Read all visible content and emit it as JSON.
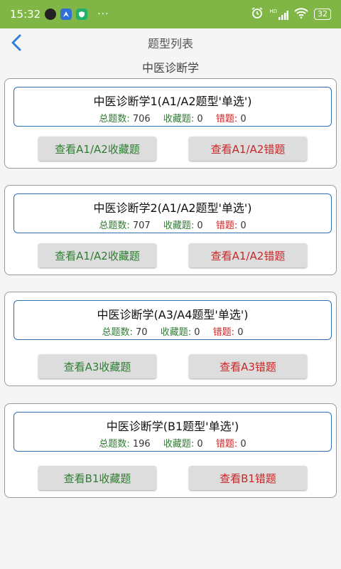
{
  "status_bar": {
    "time": "15:32",
    "dots": "···",
    "battery": "32",
    "hd_label": "HD"
  },
  "header": {
    "title": "题型列表",
    "back_icon": "chevron-left-icon"
  },
  "section": {
    "title": "中医诊断学"
  },
  "labels": {
    "total": "总题数:",
    "fav": "收藏题:",
    "wrong": "错题:"
  },
  "cards": [
    {
      "title": "中医诊断学1(A1/A2题型'单选')",
      "total": "706",
      "fav": "0",
      "wrong": "0",
      "fav_button": "查看A1/A2收藏题",
      "wrong_button": "查看A1/A2错题"
    },
    {
      "title": "中医诊断学2(A1/A2题型'单选')",
      "total": "707",
      "fav": "0",
      "wrong": "0",
      "fav_button": "查看A1/A2收藏题",
      "wrong_button": "查看A1/A2错题"
    },
    {
      "title": "中医诊断学(A3/A4题型'单选')",
      "total": "70",
      "fav": "0",
      "wrong": "0",
      "fav_button": "查看A3收藏题",
      "wrong_button": "查看A3错题"
    },
    {
      "title": "中医诊断学(B1题型'单选')",
      "total": "196",
      "fav": "0",
      "wrong": "0",
      "fav_button": "查看B1收藏题",
      "wrong_button": "查看B1错题"
    }
  ],
  "colors": {
    "status_bar": "#7fb646",
    "accent_blue": "#2f6fb5",
    "green_text": "#2e7d32",
    "red_text": "#c62828"
  }
}
